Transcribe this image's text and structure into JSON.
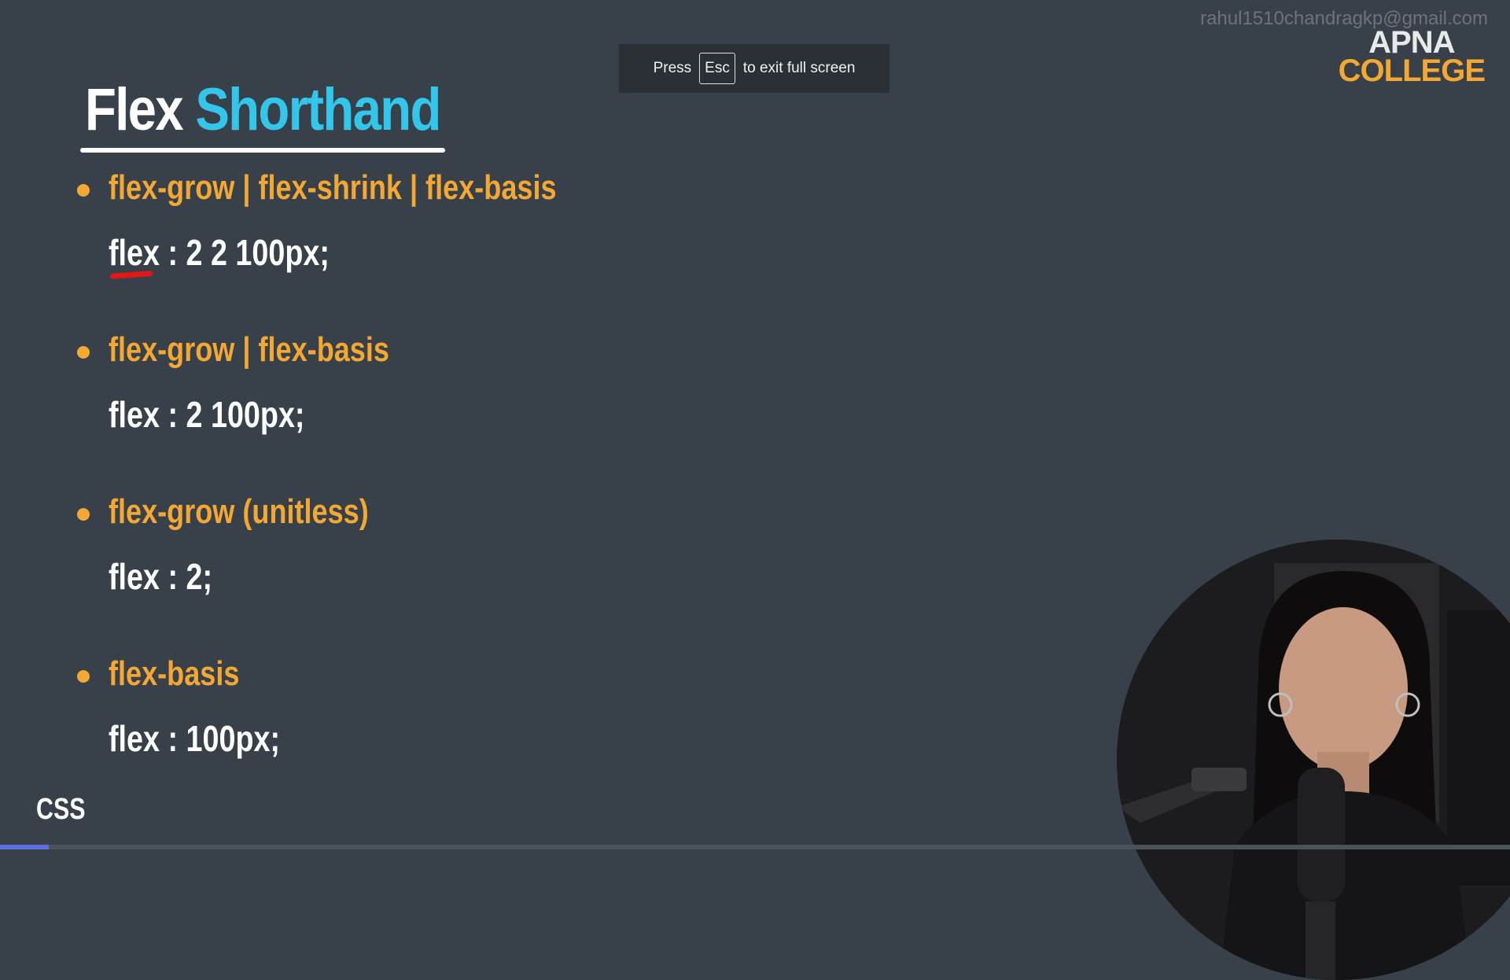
{
  "watermark": "rahul1510chandragkp@gmail.com",
  "logo": {
    "line1": "APNA",
    "line2": "COLLEGE"
  },
  "fullscreen_banner": {
    "press": "Press",
    "key": "Esc",
    "rest": "to exit full screen"
  },
  "title": {
    "word1": "Flex",
    "word2": "Shorthand"
  },
  "sections": [
    {
      "heading": "flex-grow | flex-shrink | flex-basis",
      "code": "flex : 2 2 100px;"
    },
    {
      "heading": "flex-grow | flex-basis",
      "code": "flex : 2 100px;"
    },
    {
      "heading": "flex-grow (unitless)",
      "code": "flex : 2;"
    },
    {
      "heading": "flex-basis",
      "code": "flex : 100px;"
    }
  ],
  "footer_label": "CSS",
  "colors": {
    "background": "#38404a",
    "accent_orange": "#f2a833",
    "accent_cyan": "#34c6ea",
    "annotation_red": "#e01818"
  }
}
